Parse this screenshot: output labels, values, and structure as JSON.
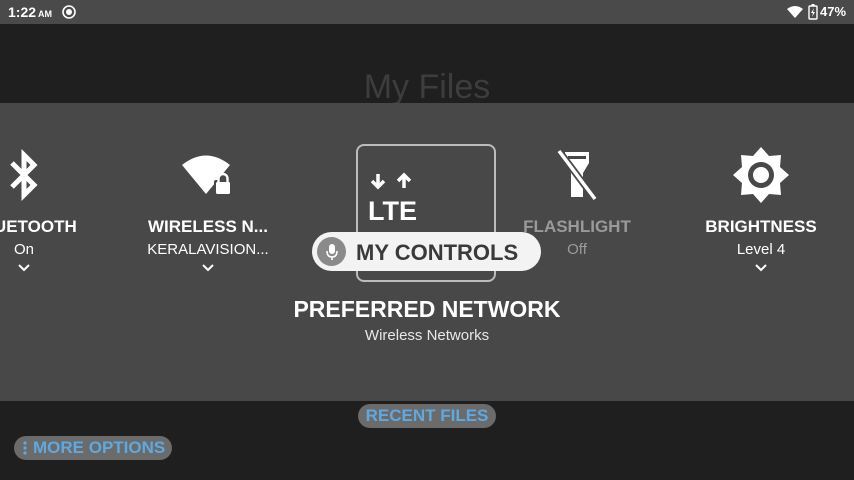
{
  "status_bar": {
    "time": "1:22",
    "ampm": "AM",
    "battery": "47%"
  },
  "app": {
    "title": "My Files"
  },
  "tiles": [
    {
      "label": "BLUETOOTH",
      "value": "On",
      "icon": "bluetooth-icon"
    },
    {
      "label": "WIRELESS N...",
      "value": "KERALAVISION...",
      "icon": "wifi-locked-icon"
    },
    {
      "label": "PREFERRED NETWORK",
      "value": "Wireless Networks",
      "icon": "lte-icon"
    },
    {
      "label": "FLASHLIGHT",
      "value": "Off",
      "icon": "flashlight-off-icon"
    },
    {
      "label": "BRIGHTNESS",
      "value": "Level 4",
      "icon": "brightness-icon"
    }
  ],
  "overlay": {
    "label": "MY CONTROLS",
    "icon": "microphone-icon"
  },
  "bottom": {
    "recent_files": "RECENT FILES",
    "more_options": "MORE OPTIONS"
  }
}
